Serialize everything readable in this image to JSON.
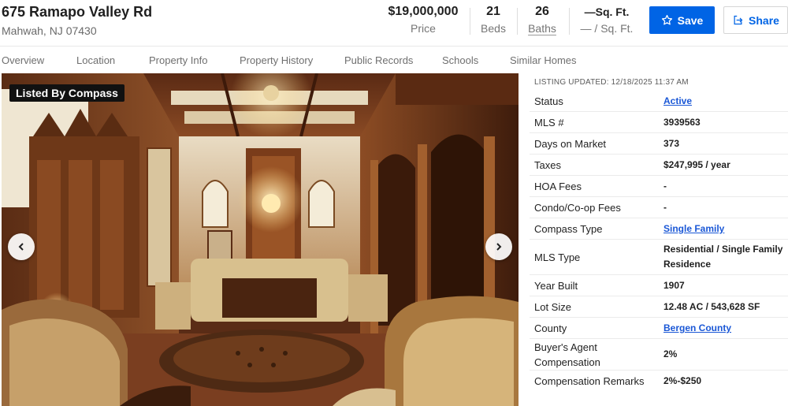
{
  "header": {
    "address_line1": "675 Ramapo Valley Rd",
    "address_line2": "Mahwah, NJ 07430",
    "price": {
      "value": "$19,000,000",
      "label": "Price"
    },
    "beds": {
      "value": "21",
      "label": "Beds"
    },
    "baths": {
      "value": "26",
      "label": "Baths"
    },
    "sqft": {
      "value": "—Sq. Ft.",
      "label": "— / Sq. Ft."
    },
    "save_label": "Save",
    "share_label": "Share",
    "accent": "#0064e5"
  },
  "tabs": [
    "Overview",
    "Location",
    "Property Info",
    "Property History",
    "Public Records",
    "Schools",
    "Similar Homes"
  ],
  "photo": {
    "badge": "Listed By Compass",
    "prev_icon": "chevron-left-icon",
    "next_icon": "chevron-right-icon"
  },
  "details": {
    "updated": "LISTING UPDATED: 12/18/2025 11:37 AM",
    "rows": [
      {
        "label": "Status",
        "value": "Active",
        "link": true
      },
      {
        "label": "MLS #",
        "value": "3939563"
      },
      {
        "label": "Days on Market",
        "value": "373"
      },
      {
        "label": "Taxes",
        "value": "$247,995 / year"
      },
      {
        "label": "HOA Fees",
        "value": "-"
      },
      {
        "label": "Condo/Co-op Fees",
        "value": "-"
      },
      {
        "label": "Compass Type",
        "value": "Single Family",
        "link": true
      },
      {
        "label": "MLS Type",
        "value": "Residential / Single Family Residence"
      },
      {
        "label": "Year Built",
        "value": "1907"
      },
      {
        "label": "Lot Size",
        "value": "12.48 AC / 543,628 SF"
      },
      {
        "label": "County",
        "value": "Bergen County",
        "link": true
      },
      {
        "label": "Buyer's Agent Compensation",
        "value": "2%"
      },
      {
        "label": "Compensation Remarks",
        "value": "2%-$250"
      }
    ]
  }
}
